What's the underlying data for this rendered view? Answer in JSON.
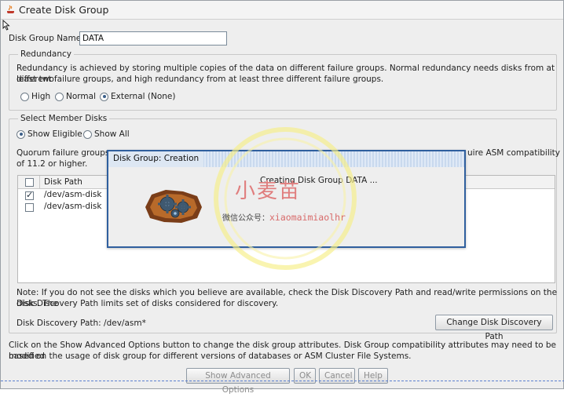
{
  "window": {
    "title": "Create Disk Group"
  },
  "disk_group_name": {
    "label": "Disk Group Name",
    "value": "DATA"
  },
  "redundancy": {
    "legend": "Redundancy",
    "description_line1": "Redundancy is achieved by storing multiple copies of the data on different failure groups. Normal redundancy needs disks from at least two",
    "description_line2": "different failure groups, and high redundancy from at least three different failure groups.",
    "options": [
      {
        "label": "High",
        "selected": false
      },
      {
        "label": "Normal",
        "selected": false
      },
      {
        "label": "External (None)",
        "selected": true
      }
    ]
  },
  "member_disks": {
    "legend": "Select Member Disks",
    "options": [
      {
        "label": "Show Eligible",
        "selected": true
      },
      {
        "label": "Show All",
        "selected": false
      }
    ],
    "quorum_left": "Quorum failure groups",
    "quorum_right": "uire ASM compatibility",
    "quorum_line2": "of 11.2 or higher.",
    "table": {
      "column_header": "Disk Path",
      "rows": [
        {
          "path": "/dev/asm-disk",
          "checked": true
        },
        {
          "path": "/dev/asm-disk",
          "checked": false
        }
      ]
    },
    "note_line1": "Note: If you do not see the disks which you believe are available, check the Disk Discovery Path and read/write permissions on the disks. The",
    "note_line2": "Disk Discovery Path limits set of disks considered for discovery.",
    "discovery_path_text": "Disk Discovery Path: /dev/asm*",
    "change_discovery_button": "Change Disk Discovery Path"
  },
  "advanced_info_line1": "Click on the Show Advanced Options button to change the disk group attributes. Disk Group compatibility attributes may need to be modified",
  "advanced_info_line2": "based on the usage of disk group for different versions of databases or ASM Cluster File Systems.",
  "buttons": {
    "show_advanced": "Show Advanced Options",
    "ok": "OK",
    "cancel": "Cancel",
    "help": "Help"
  },
  "progress_dialog": {
    "title": "Disk Group: Creation",
    "message": "Creating Disk Group DATA ..."
  },
  "watermark": {
    "title": "小麦苗",
    "sub_label": "微信公众号：",
    "handle": "xiaomaimiaolhr"
  },
  "colors": {
    "dialog_border": "#2f5f9e",
    "watermark_ring": "#f4ec7a",
    "watermark_text": "#e07e7e"
  },
  "icons": [
    "app-java-icon",
    "mouse-cursor-icon",
    "gear-progress-icon"
  ]
}
